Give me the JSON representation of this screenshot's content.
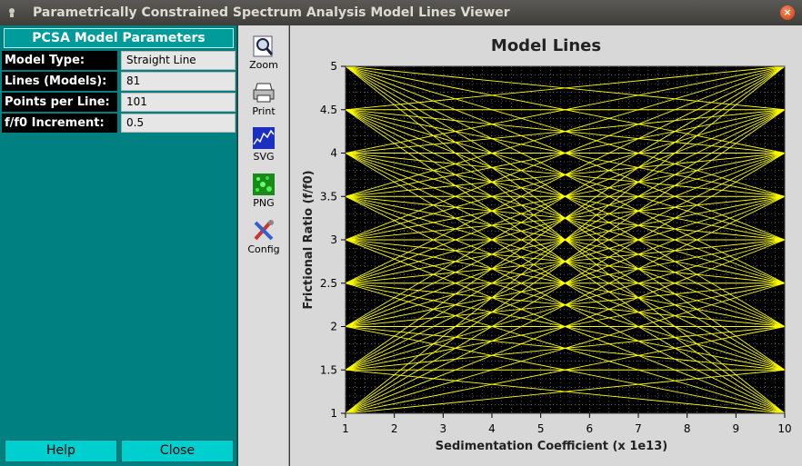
{
  "window": {
    "title": "Parametrically Constrained Spectrum Analysis Model Lines Viewer"
  },
  "panel": {
    "header": "PCSA Model Parameters",
    "params": [
      {
        "label": "Model Type:",
        "value": "Straight Line"
      },
      {
        "label": "Lines (Models):",
        "value": "81"
      },
      {
        "label": "Points per Line:",
        "value": "101"
      },
      {
        "label": "f/f0 Increment:",
        "value": "0.5"
      }
    ],
    "help_label": "Help",
    "close_label": "Close"
  },
  "toolbar": {
    "items": [
      {
        "label": "Zoom",
        "icon": "zoom-icon"
      },
      {
        "label": "Print",
        "icon": "printer-icon"
      },
      {
        "label": "SVG",
        "icon": "svg-icon"
      },
      {
        "label": "PNG",
        "icon": "png-icon"
      },
      {
        "label": "Config",
        "icon": "config-icon"
      }
    ]
  },
  "colors": {
    "panel": "#008080",
    "plot_bg": "#000000",
    "line": "#ffff00",
    "grid": "#808080"
  },
  "chart_data": {
    "type": "line",
    "title": "Model Lines",
    "xlabel": "Sedimentation Coefficient (x 1e13)",
    "ylabel": "Frictional Ratio (f/f0)",
    "xlim": [
      1,
      10
    ],
    "ylim": [
      1,
      5
    ],
    "x_ticks": [
      1,
      2,
      3,
      4,
      5,
      6,
      7,
      8,
      9,
      10
    ],
    "y_ticks": [
      1,
      1.5,
      2,
      2.5,
      3,
      3.5,
      4,
      4.5,
      5
    ],
    "grid": true,
    "description_rule": "81 straight lines connecting every start f/f0 at s=1 to every end f/f0 at s=10",
    "start_values": [
      1,
      1.5,
      2,
      2.5,
      3,
      3.5,
      4,
      4.5,
      5
    ],
    "end_values": [
      1,
      1.5,
      2,
      2.5,
      3,
      3.5,
      4,
      4.5,
      5
    ],
    "points_per_line": 101
  }
}
